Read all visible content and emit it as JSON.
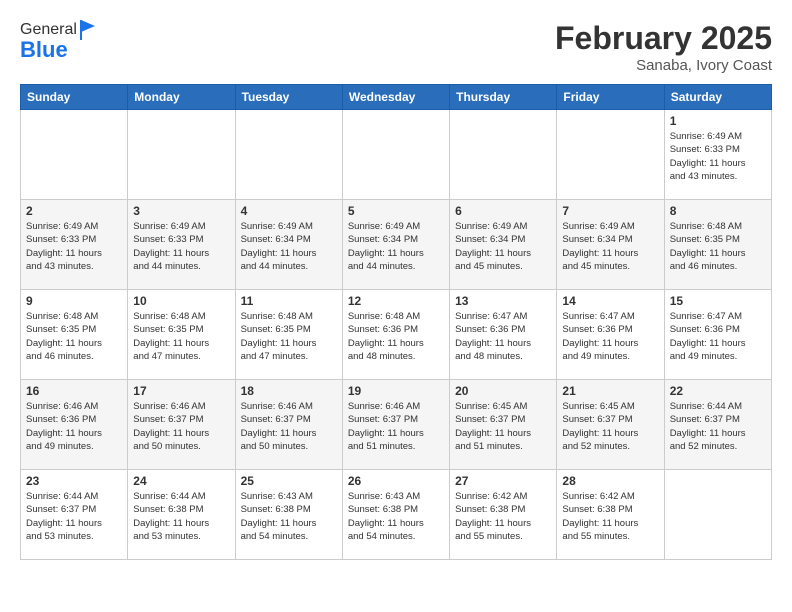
{
  "header": {
    "logo_general": "General",
    "logo_blue": "Blue",
    "month_title": "February 2025",
    "subtitle": "Sanaba, Ivory Coast"
  },
  "days_of_week": [
    "Sunday",
    "Monday",
    "Tuesday",
    "Wednesday",
    "Thursday",
    "Friday",
    "Saturday"
  ],
  "weeks": [
    [
      {
        "day": "",
        "info": ""
      },
      {
        "day": "",
        "info": ""
      },
      {
        "day": "",
        "info": ""
      },
      {
        "day": "",
        "info": ""
      },
      {
        "day": "",
        "info": ""
      },
      {
        "day": "",
        "info": ""
      },
      {
        "day": "1",
        "info": "Sunrise: 6:49 AM\nSunset: 6:33 PM\nDaylight: 11 hours\nand 43 minutes."
      }
    ],
    [
      {
        "day": "2",
        "info": "Sunrise: 6:49 AM\nSunset: 6:33 PM\nDaylight: 11 hours\nand 43 minutes."
      },
      {
        "day": "3",
        "info": "Sunrise: 6:49 AM\nSunset: 6:33 PM\nDaylight: 11 hours\nand 44 minutes."
      },
      {
        "day": "4",
        "info": "Sunrise: 6:49 AM\nSunset: 6:34 PM\nDaylight: 11 hours\nand 44 minutes."
      },
      {
        "day": "5",
        "info": "Sunrise: 6:49 AM\nSunset: 6:34 PM\nDaylight: 11 hours\nand 44 minutes."
      },
      {
        "day": "6",
        "info": "Sunrise: 6:49 AM\nSunset: 6:34 PM\nDaylight: 11 hours\nand 45 minutes."
      },
      {
        "day": "7",
        "info": "Sunrise: 6:49 AM\nSunset: 6:34 PM\nDaylight: 11 hours\nand 45 minutes."
      },
      {
        "day": "8",
        "info": "Sunrise: 6:48 AM\nSunset: 6:35 PM\nDaylight: 11 hours\nand 46 minutes."
      }
    ],
    [
      {
        "day": "9",
        "info": "Sunrise: 6:48 AM\nSunset: 6:35 PM\nDaylight: 11 hours\nand 46 minutes."
      },
      {
        "day": "10",
        "info": "Sunrise: 6:48 AM\nSunset: 6:35 PM\nDaylight: 11 hours\nand 47 minutes."
      },
      {
        "day": "11",
        "info": "Sunrise: 6:48 AM\nSunset: 6:35 PM\nDaylight: 11 hours\nand 47 minutes."
      },
      {
        "day": "12",
        "info": "Sunrise: 6:48 AM\nSunset: 6:36 PM\nDaylight: 11 hours\nand 48 minutes."
      },
      {
        "day": "13",
        "info": "Sunrise: 6:47 AM\nSunset: 6:36 PM\nDaylight: 11 hours\nand 48 minutes."
      },
      {
        "day": "14",
        "info": "Sunrise: 6:47 AM\nSunset: 6:36 PM\nDaylight: 11 hours\nand 49 minutes."
      },
      {
        "day": "15",
        "info": "Sunrise: 6:47 AM\nSunset: 6:36 PM\nDaylight: 11 hours\nand 49 minutes."
      }
    ],
    [
      {
        "day": "16",
        "info": "Sunrise: 6:46 AM\nSunset: 6:36 PM\nDaylight: 11 hours\nand 49 minutes."
      },
      {
        "day": "17",
        "info": "Sunrise: 6:46 AM\nSunset: 6:37 PM\nDaylight: 11 hours\nand 50 minutes."
      },
      {
        "day": "18",
        "info": "Sunrise: 6:46 AM\nSunset: 6:37 PM\nDaylight: 11 hours\nand 50 minutes."
      },
      {
        "day": "19",
        "info": "Sunrise: 6:46 AM\nSunset: 6:37 PM\nDaylight: 11 hours\nand 51 minutes."
      },
      {
        "day": "20",
        "info": "Sunrise: 6:45 AM\nSunset: 6:37 PM\nDaylight: 11 hours\nand 51 minutes."
      },
      {
        "day": "21",
        "info": "Sunrise: 6:45 AM\nSunset: 6:37 PM\nDaylight: 11 hours\nand 52 minutes."
      },
      {
        "day": "22",
        "info": "Sunrise: 6:44 AM\nSunset: 6:37 PM\nDaylight: 11 hours\nand 52 minutes."
      }
    ],
    [
      {
        "day": "23",
        "info": "Sunrise: 6:44 AM\nSunset: 6:37 PM\nDaylight: 11 hours\nand 53 minutes."
      },
      {
        "day": "24",
        "info": "Sunrise: 6:44 AM\nSunset: 6:38 PM\nDaylight: 11 hours\nand 53 minutes."
      },
      {
        "day": "25",
        "info": "Sunrise: 6:43 AM\nSunset: 6:38 PM\nDaylight: 11 hours\nand 54 minutes."
      },
      {
        "day": "26",
        "info": "Sunrise: 6:43 AM\nSunset: 6:38 PM\nDaylight: 11 hours\nand 54 minutes."
      },
      {
        "day": "27",
        "info": "Sunrise: 6:42 AM\nSunset: 6:38 PM\nDaylight: 11 hours\nand 55 minutes."
      },
      {
        "day": "28",
        "info": "Sunrise: 6:42 AM\nSunset: 6:38 PM\nDaylight: 11 hours\nand 55 minutes."
      },
      {
        "day": "",
        "info": ""
      }
    ]
  ]
}
